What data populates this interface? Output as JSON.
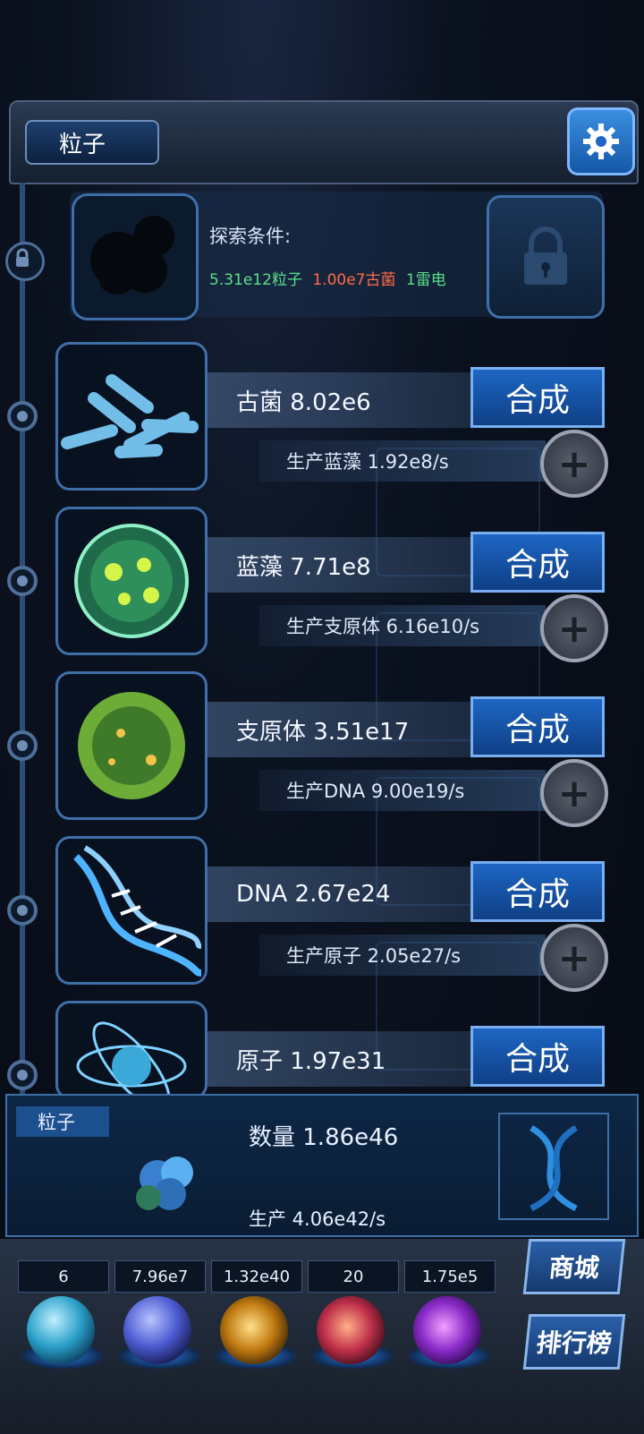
{
  "header": {
    "title": "粒子"
  },
  "explore": {
    "label": "探索条件:",
    "conditions": [
      {
        "text": "5.31e12粒子",
        "color": "#57e08a"
      },
      {
        "text": "1.00e7古菌",
        "color": "#ff6b45"
      },
      {
        "text": "1雷电",
        "color": "#57e08a"
      }
    ]
  },
  "items": [
    {
      "name": "古菌 8.02e6",
      "button": "合成",
      "production": "生产蓝藻 1.92e8/s"
    },
    {
      "name": "蓝藻 7.71e8",
      "button": "合成",
      "production": "生产支原体 6.16e10/s"
    },
    {
      "name": "支原体 3.51e17",
      "button": "合成",
      "production": "生产DNA 9.00e19/s"
    },
    {
      "name": "DNA 2.67e24",
      "button": "合成",
      "production": "生产原子 2.05e27/s"
    },
    {
      "name": "原子 1.97e31",
      "button": "合成"
    }
  ],
  "current": {
    "tag": "粒子",
    "count": "数量 1.86e46",
    "production": "生产 4.06e42/s"
  },
  "resources": [
    "6",
    "7.96e7",
    "1.32e40",
    "20",
    "1.75e5"
  ],
  "side_buttons": {
    "shop": "商城",
    "rank": "排行榜"
  },
  "colors": {
    "accent": "#1d66c4",
    "rail": "#2d4d78"
  }
}
